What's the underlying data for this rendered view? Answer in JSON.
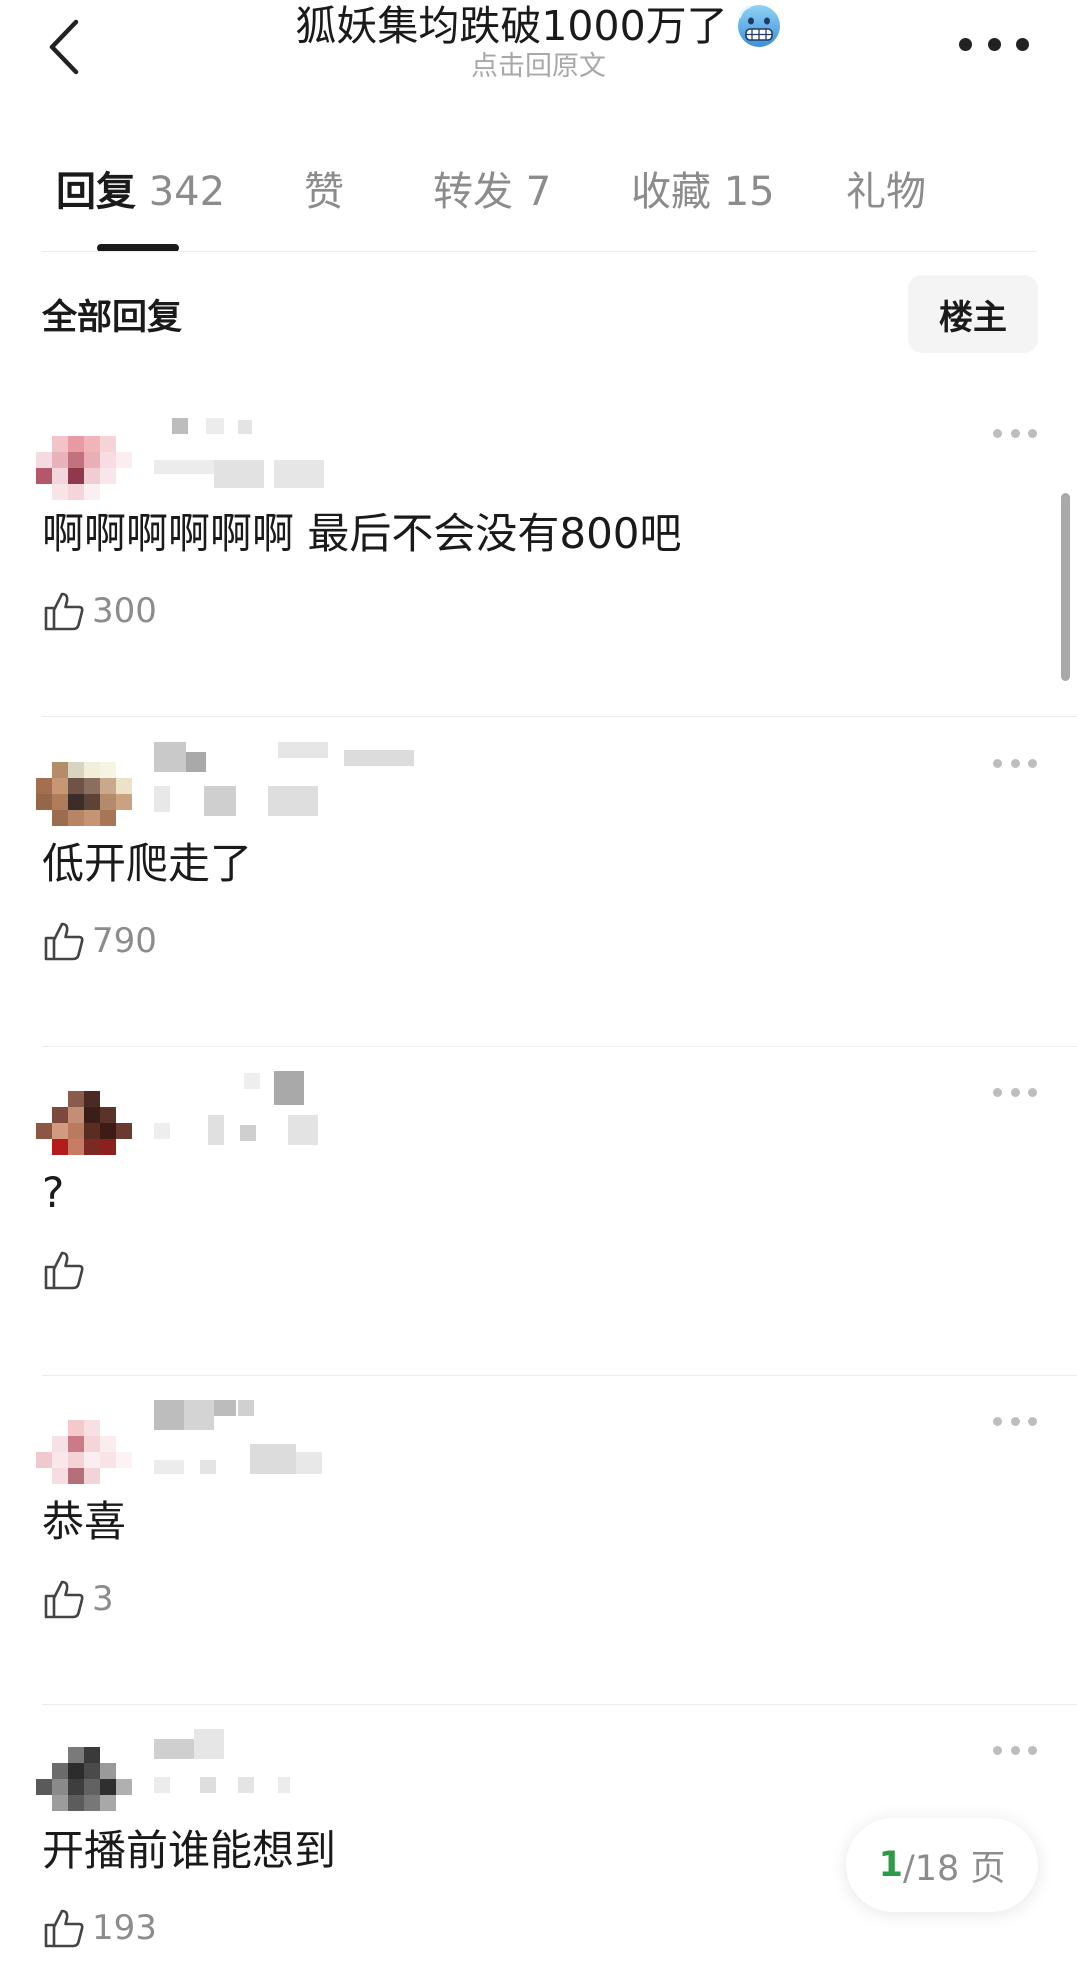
{
  "header": {
    "title": "狐妖集均跌破1000万了",
    "title_emoji": "cold-face-emoji",
    "subtitle": "点击回原文"
  },
  "tabs": [
    {
      "label": "回复",
      "count": "342",
      "active": true
    },
    {
      "label": "赞",
      "count": "",
      "active": false
    },
    {
      "label": "转发",
      "count": "7",
      "active": false
    },
    {
      "label": "收藏",
      "count": "15",
      "active": false
    },
    {
      "label": "礼物",
      "count": "",
      "active": false
    }
  ],
  "filter": {
    "title": "全部回复",
    "owner_button": "楼主"
  },
  "comments": [
    {
      "text": "啊啊啊啊啊啊 最后不会没有800吧",
      "likes": "300"
    },
    {
      "text": "低开爬走了",
      "likes": "790"
    },
    {
      "text": "?",
      "likes": ""
    },
    {
      "text": "恭喜",
      "likes": "3"
    },
    {
      "text": "开播前谁能想到",
      "likes": "193"
    }
  ],
  "pagination": {
    "current": "1",
    "total": "/18 页"
  },
  "colors": {
    "accent_green": "#2e9a46",
    "text_primary": "#1a1a1a",
    "text_secondary": "#8c8c8c"
  }
}
